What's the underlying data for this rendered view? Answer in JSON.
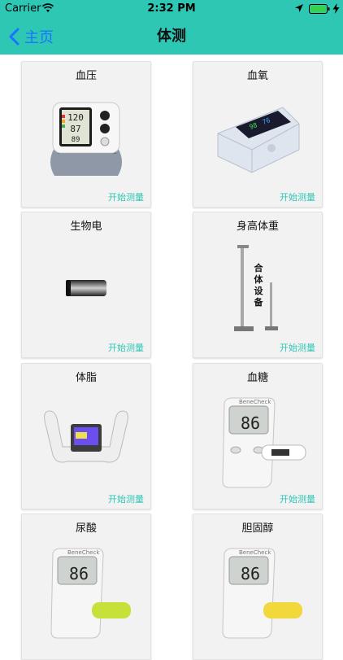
{
  "status": {
    "carrier": "Carrier",
    "time": "2:32 PM"
  },
  "nav": {
    "back_label": "主页",
    "title": "体测"
  },
  "start_label": "开始测量",
  "cards": [
    {
      "title": "血压"
    },
    {
      "title": "血氧"
    },
    {
      "title": "生物电"
    },
    {
      "title": "身高体重",
      "device_text": [
        "合",
        "体",
        "设",
        "备"
      ]
    },
    {
      "title": "体脂"
    },
    {
      "title": "血糖",
      "brand": "BeneCheck",
      "reading": "86"
    },
    {
      "title": "尿酸",
      "brand": "BeneCheck",
      "reading": "86"
    },
    {
      "title": "胆固醇",
      "brand": "BeneCheck",
      "reading": "86"
    }
  ],
  "colors": {
    "header": "#2ec7b4",
    "back": "#1a73ff",
    "accent": "#2ec7b4",
    "card_bg": "#f2f2f2"
  }
}
